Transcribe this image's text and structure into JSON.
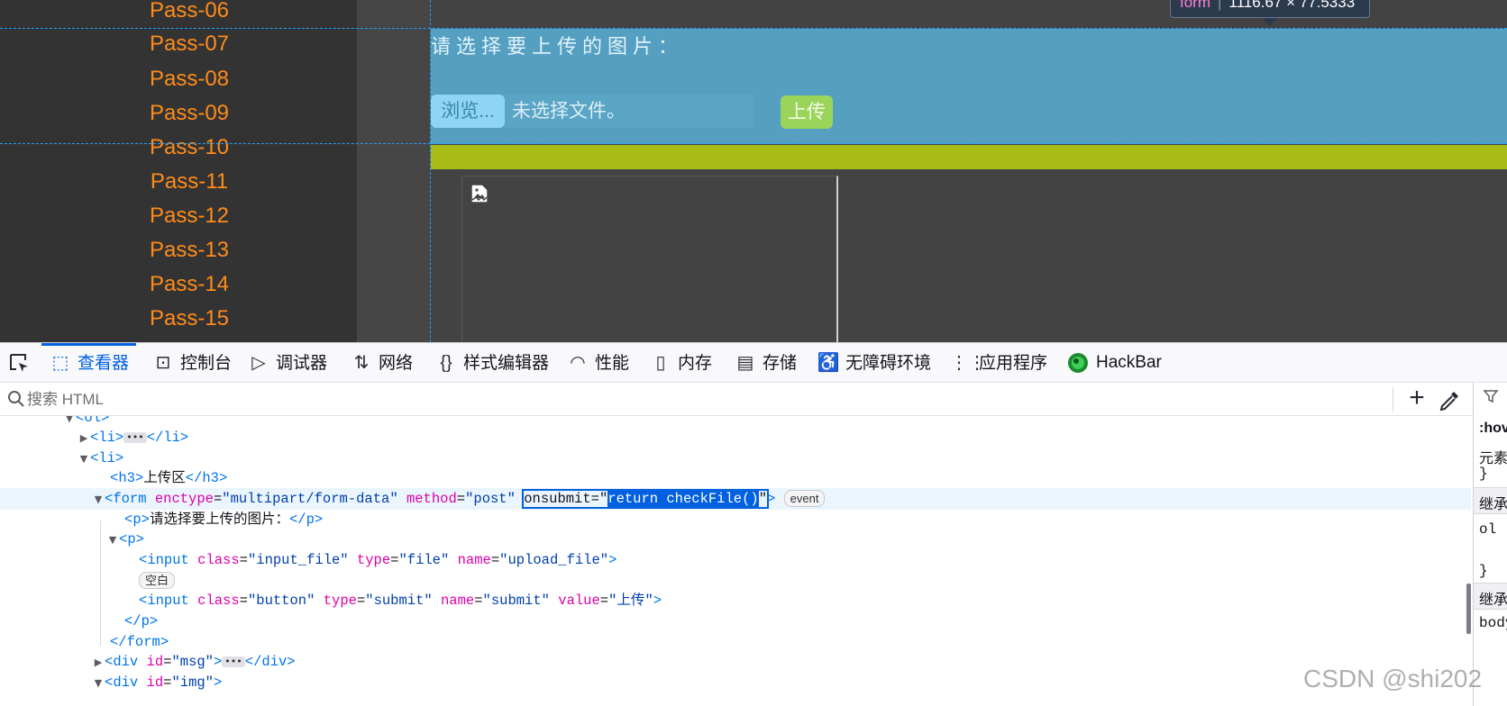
{
  "site": {
    "nav_items": [
      "Pass-06",
      "Pass-07",
      "Pass-08",
      "Pass-09",
      "Pass-10",
      "Pass-11",
      "Pass-12",
      "Pass-13",
      "Pass-14",
      "Pass-15"
    ],
    "prompt": "请选择要上传的图片：",
    "browse_label": "浏览...",
    "file_status": "未选择文件。",
    "upload_label": "上传",
    "tooltip": {
      "tag": "form",
      "size": "1116.67 × 77.5333"
    },
    "colors": {
      "nav_text": "#ff8c1a",
      "form_bg": "#55a0c1",
      "msg_bar": "#a8bb17",
      "upload_btn": "#9bd45b"
    }
  },
  "devtools": {
    "tabs": [
      "查看器",
      "控制台",
      "调试器",
      "网络",
      "样式编辑器",
      "性能",
      "内存",
      "存储",
      "无障碍环境",
      "应用程序",
      "HackBar"
    ],
    "tab_icons": [
      "inspector-icon",
      "console-icon",
      "debugger-icon",
      "network-icon",
      "style-editor-icon",
      "performance-icon",
      "memory-icon",
      "storage-icon",
      "accessibility-icon",
      "application-icon",
      "hackbar-icon"
    ],
    "active_tab": "查看器",
    "search_placeholder": "搜索 HTML",
    "tree": {
      "ol_tag": "ol",
      "li_collapsed": {
        "open": "li",
        "close": "li"
      },
      "li_open": "li",
      "h3": {
        "tag": "h3",
        "text": "上传区"
      },
      "form": {
        "tag": "form",
        "attr1_name": "enctype",
        "attr1_val": "multipart/form-data",
        "attr2_name": "method",
        "attr2_val": "post",
        "attr3_name": "onsubmit",
        "attr3_val": "return checkFile()",
        "badge": "event"
      },
      "p_text": {
        "tag": "p",
        "text": "请选择要上传的图片："
      },
      "p_open": "p",
      "input_file": {
        "tag": "input",
        "class_name": "class",
        "class_val": "input_file",
        "type_name": "type",
        "type_val": "file",
        "name_name": "name",
        "name_val": "upload_file"
      },
      "whitespace_badge": "空白",
      "input_submit": {
        "tag": "input",
        "class_name": "class",
        "class_val": "button",
        "type_name": "type",
        "type_val": "submit",
        "name_name": "name",
        "name_val": "submit",
        "value_name": "value",
        "value_val": "上传"
      },
      "p_close": "p",
      "form_close": "form",
      "div_msg": {
        "tag": "div",
        "attr_name": "id",
        "attr_val": "msg"
      },
      "div_img": {
        "tag": "div",
        "attr_name": "id",
        "attr_val": "img"
      }
    },
    "rules_pane": {
      "lines": [
        ":hov",
        "元素",
        "}",
        "继承",
        "ol",
        "}",
        "继承",
        "body"
      ]
    }
  },
  "watermark": "CSDN @shi202"
}
